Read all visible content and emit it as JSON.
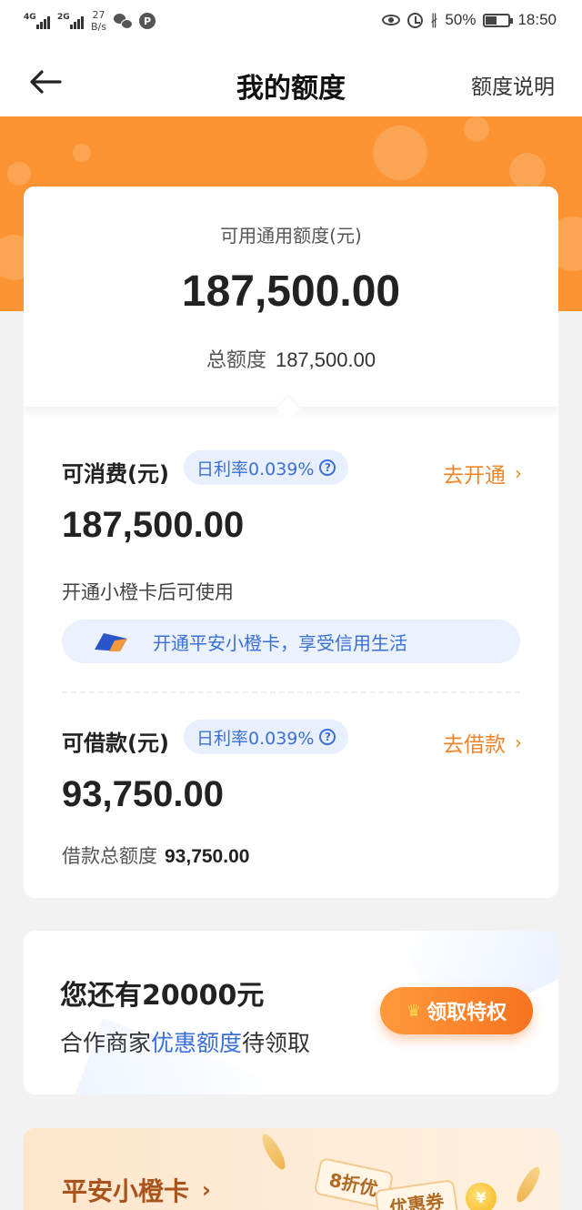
{
  "status_bar": {
    "network_1": "4G",
    "network_2": "2G",
    "speed_value": "27",
    "speed_unit": "B/s",
    "p_badge": "P",
    "battery": "50%",
    "battery_level": 0.5,
    "time": "18:50",
    "bluetooth_glyph": "∦"
  },
  "nav": {
    "title": "我的额度",
    "right_link": "额度说明"
  },
  "summary": {
    "available_label": "可用通用额度(元)",
    "available_value": "187,500.00",
    "total_label": "总额度",
    "total_value": "187,500.00"
  },
  "consume": {
    "title": "可消费(元)",
    "rate": "日利率0.039%",
    "action": "去开通",
    "amount": "187,500.00",
    "hint": "开通小橙卡后可使用",
    "promo": "开通平安小橙卡，享受信用生活"
  },
  "loan": {
    "title": "可借款(元)",
    "rate": "日利率0.039%",
    "action": "去借款",
    "amount": "93,750.00",
    "total_label": "借款总额度",
    "total_value": "93,750.00"
  },
  "promo_card": {
    "headline": "您还有20000元",
    "sub_prefix": "合作商家",
    "sub_highlight": "优惠额度",
    "sub_suffix": "待领取",
    "button": "领取特权"
  },
  "bottom_card": {
    "title": "平安小橙卡",
    "coupon_discount": "8折优",
    "coupon_label": "优惠券"
  },
  "colors": {
    "orange_band": "#fb9332",
    "accent_orange": "#f0862b",
    "accent_blue": "#3a6fd8"
  },
  "icons": {
    "back": "arrow-left-icon",
    "chevron": "chevron-right-icon",
    "question": "question-circle-icon",
    "crown": "crown-icon"
  }
}
